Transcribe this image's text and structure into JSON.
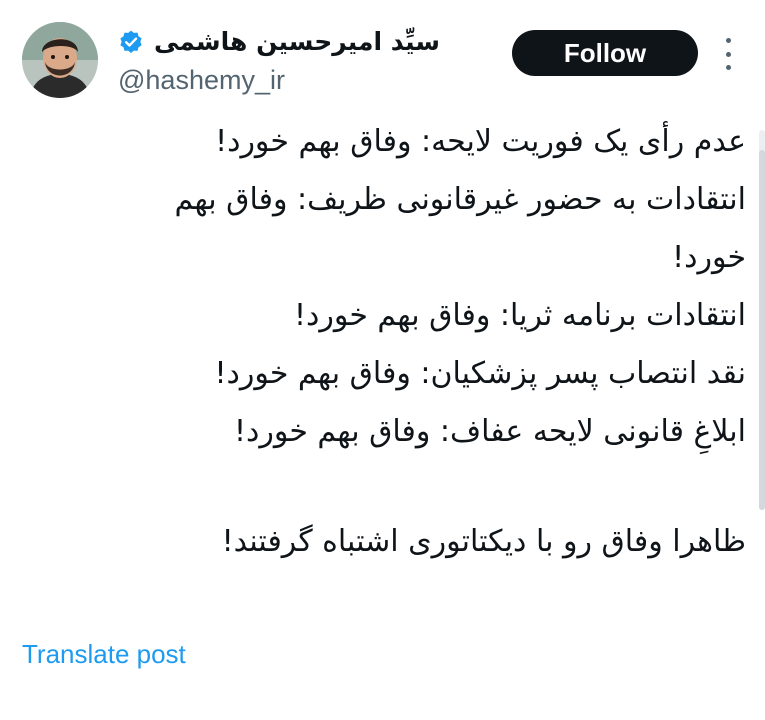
{
  "author": {
    "display_name": "سیِّد امیرحسین هاشمی",
    "handle": "@hashemy_ir",
    "verified": true,
    "avatar_icon": "user-avatar"
  },
  "actions": {
    "follow_label": "Follow",
    "more_icon": "more-vertical-icon"
  },
  "post": {
    "lines": [
      "عدم رأی یک فوریت لایحه: وفاق بهم خورد!",
      "انتقادات به حضور غیرقانونی ظریف: وفاق بهم",
      "خورد!",
      "انتقادات برنامه ثریا: وفاق بهم خورد!",
      "نقد انتصاب پسر پزشکیان: وفاق بهم خورد!",
      "ابلاغِ قانونی لایحه عفاف: وفاق بهم خورد!",
      "ظاهرا وفاق رو با دیکتاتوری اشتباه گرفتند!"
    ]
  },
  "footer": {
    "translate_label": "Translate post"
  },
  "colors": {
    "text": "#0f1419",
    "secondary": "#536471",
    "link": "#1d9bf0",
    "follow_bg": "#0f1419",
    "follow_text": "#ffffff",
    "verified_badge": "#1d9bf0"
  }
}
